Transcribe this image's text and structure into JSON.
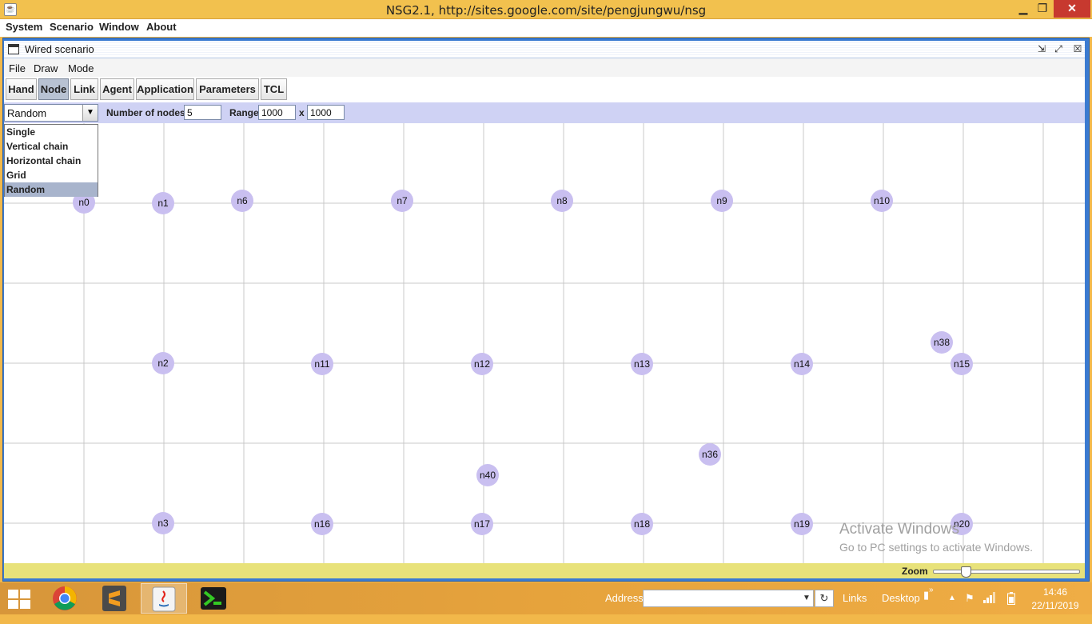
{
  "window": {
    "title": "NSG2.1, http://sites.google.com/site/pengjungwu/nsg",
    "app_icon": "java-icon",
    "minimize_label": "▁",
    "maximize_label": "❐",
    "close_label": "✕"
  },
  "menubar": {
    "items": [
      "System",
      "Scenario",
      "Window",
      "About"
    ]
  },
  "inner_window": {
    "title": "Wired scenario",
    "controls": [
      "⇲",
      "⤢",
      "☒"
    ],
    "menu": [
      "File",
      "Draw",
      "Mode"
    ]
  },
  "toolbar": {
    "buttons": [
      "Hand",
      "Node",
      "Link",
      "Agent",
      "Application",
      "Parameters",
      "TCL"
    ],
    "active": "Node"
  },
  "options": {
    "mode_value": "Random",
    "arrow": "▼",
    "num_nodes_label": "Number of nodes",
    "num_nodes_value": "5",
    "range_label": "Range",
    "range_x": "1000",
    "x_label": "x",
    "range_y": "1000"
  },
  "dropdown": {
    "options": [
      "Single",
      "Vertical chain",
      "Horizontal chain",
      "Grid",
      "Random"
    ],
    "selected": "Random"
  },
  "nodes": [
    "n0",
    "n1",
    "n6",
    "n7",
    "n8",
    "n9",
    "n10",
    "n38",
    "n2",
    "n11",
    "n12",
    "n13",
    "n14",
    "n15",
    "n36",
    "n40",
    "n3",
    "n16",
    "n17",
    "n18",
    "n19",
    "n20"
  ],
  "watermark": {
    "line1": "Activate Windows",
    "line2": "Go to PC settings to activate Windows."
  },
  "statusbar": {
    "zoom_label": "Zoom",
    "zoom_level": 0.2
  },
  "taskbar": {
    "apps": [
      "chrome-icon",
      "sublime-text-icon",
      "java-icon",
      "terminal-icon"
    ],
    "address_label": "Address",
    "address_value": "",
    "links_label": "Links",
    "desktop_label": "Desktop",
    "time": "14:46",
    "date": "22/11/2019"
  },
  "colors": {
    "titlebar": "#f2c14e",
    "frame": "#3b7bd1",
    "option_bar": "#cfd2f4",
    "node_fill": "#c9bff0",
    "statusbar": "#e8e27a",
    "taskbar": "#e6a33c",
    "close_button": "#c7392f"
  }
}
